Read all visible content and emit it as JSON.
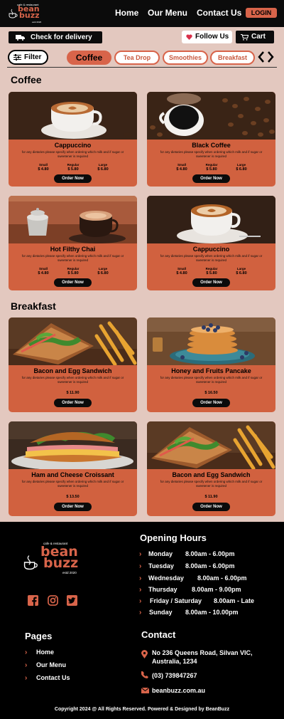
{
  "header": {
    "logo": {
      "tagline": "cafe & restaurant",
      "word1": "bean",
      "word2": "buzz",
      "established": "estd 2020"
    },
    "nav": [
      "Home",
      "Our Menu",
      "Contact Us"
    ],
    "login_label": "LOGIN"
  },
  "actions": {
    "delivery_label": "Check for delivery",
    "follow_label": "Follow Us",
    "cart_label": "Cart",
    "filter_label": "Filter"
  },
  "tabs": [
    {
      "label": "Coffee",
      "active": true
    },
    {
      "label": "Tea Drop",
      "active": false
    },
    {
      "label": "Smoothies",
      "active": false
    },
    {
      "label": "Breakfast",
      "active": false
    }
  ],
  "sections": {
    "coffee_title": "Coffee",
    "breakfast_title": "Breakfast"
  },
  "coffee_items": [
    {
      "name": "Cappuccino",
      "desc": "for any dietaries please specify when ordering which milk and if sugar or sweetener is required",
      "sizes": [
        {
          "name": "Small",
          "price": "$ 4.80"
        },
        {
          "name": "Regular",
          "price": "$ 5.80"
        },
        {
          "name": "Large",
          "price": "$ 6.80"
        }
      ],
      "order_label": "Order Now"
    },
    {
      "name": "Black Coffee",
      "desc": "for any dietaries please specify when ordering which milk and if sugar or sweetener is required",
      "sizes": [
        {
          "name": "Small",
          "price": "$ 4.80"
        },
        {
          "name": "Regular",
          "price": "$ 5.80"
        },
        {
          "name": "Large",
          "price": "$ 6.80"
        }
      ],
      "order_label": "Order Now"
    },
    {
      "name": "Hot Filthy Chai",
      "desc": "for any dietaries please specify when ordering which milk and if sugar or sweetener is required",
      "sizes": [
        {
          "name": "Small",
          "price": "$ 4.80"
        },
        {
          "name": "Regular",
          "price": "$ 5.80"
        },
        {
          "name": "Large",
          "price": "$ 6.80"
        }
      ],
      "order_label": "Order Now"
    },
    {
      "name": "Cappuccino",
      "desc": "for any dietaries please specify when ordering which milk and if sugar or sweetener is required",
      "sizes": [
        {
          "name": "Small",
          "price": "$ 4.80"
        },
        {
          "name": "Regular",
          "price": "$ 5.80"
        },
        {
          "name": "Large",
          "price": "$ 6.80"
        }
      ],
      "order_label": "Order Now"
    }
  ],
  "breakfast_items": [
    {
      "name": "Bacon and Egg Sandwich",
      "desc": "for any dietaries please specify when ordering which milk and if sugar or sweetener is required",
      "price": "$ 11.90",
      "order_label": "Order Now"
    },
    {
      "name": "Honey and Fruits Pancake",
      "desc": "for any dietaries please specify when ordering which milk and if sugar or sweetener is required",
      "price": "$ 16.50",
      "order_label": "Order Now"
    },
    {
      "name": "Ham and Cheese Croissant",
      "desc": "for any dietaries please specify when ordering which milk and if sugar or sweetener is required",
      "price": "$ 13.50",
      "order_label": "Order Now"
    },
    {
      "name": "Bacon and Egg Sandwich",
      "desc": "for any dietaries please specify when ordering which milk and if sugar or sweetener is required",
      "price": "$ 11.90",
      "order_label": "Order Now"
    }
  ],
  "footer": {
    "logo": {
      "tagline": "cafe & restaurant",
      "word1": "bean",
      "word2": "buzz",
      "established": "estd 2020"
    },
    "hours_title": "Opening Hours",
    "hours": [
      {
        "day": "Monday",
        "time": "8.00am  -  6.00pm"
      },
      {
        "day": "Tuesday",
        "time": "8.00am  -  6.00pm"
      },
      {
        "day": "Wednesday",
        "time": "8.00am  -  6.00pm"
      },
      {
        "day": "Thursday",
        "time": "8.00am  -  9.00pm"
      },
      {
        "day": "Friday  /  Saturday",
        "time": "8.00am  -  Late"
      },
      {
        "day": "Sunday",
        "time": "8.00am  -  10.00pm"
      }
    ],
    "pages_title": "Pages",
    "pages": [
      "Home",
      "Our Menu",
      "Contact Us"
    ],
    "contact_title": "Contact",
    "address": "No 236 Queens Road, Silvan VIC, Australia, 1234",
    "phone": "(03) 739847267",
    "email": "beanbuzz.com.au",
    "copyright": "Copyright 2024 @ All Rights Reserved. Powered & Designed by BeanBuzz"
  },
  "colors": {
    "accent": "#d8644a",
    "card": "#d1613f",
    "background": "#e3c8bf",
    "dark": "#0b0b0b"
  },
  "icons": [
    "truck-icon",
    "heart-icon",
    "cart-icon",
    "filter-icon",
    "chevron-left-icon",
    "chevron-right-icon",
    "facebook-icon",
    "instagram-icon",
    "twitter-icon",
    "location-icon",
    "phone-icon",
    "mail-icon"
  ]
}
